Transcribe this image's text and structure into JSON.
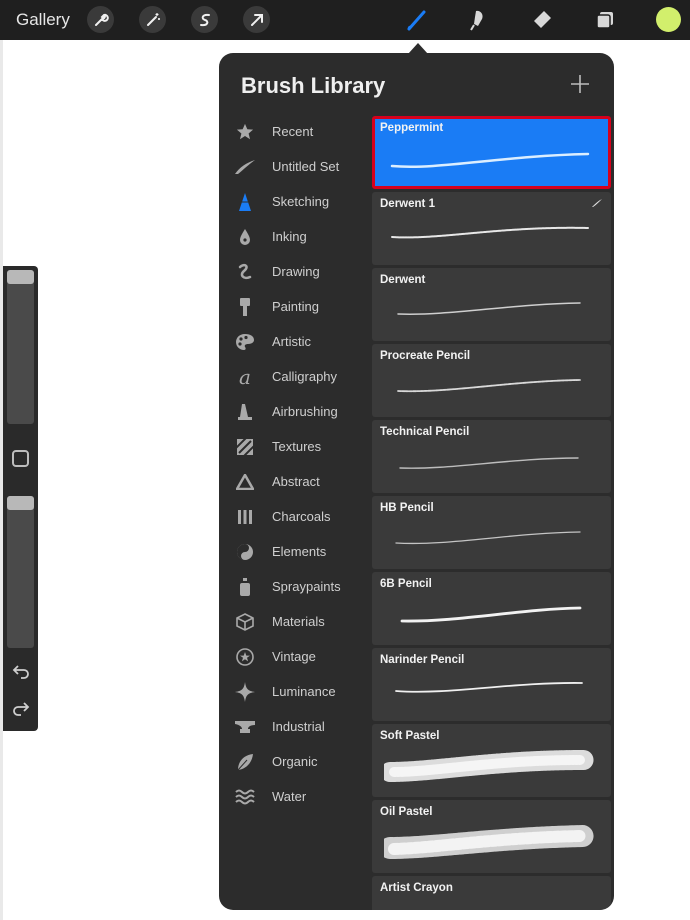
{
  "topbar": {
    "gallery_label": "Gallery",
    "tools": [
      "wrench-icon",
      "magic-wand-icon",
      "selection-s-icon",
      "transform-arrow-icon"
    ],
    "right_tools": [
      "brush-icon",
      "smudge-icon",
      "eraser-icon",
      "layers-icon"
    ],
    "active_tool": "brush",
    "accent_color": "#1a7cf5",
    "current_color": "#d2ef6c"
  },
  "library": {
    "title": "Brush Library",
    "sets": [
      {
        "label": "Recent",
        "icon": "star-icon"
      },
      {
        "label": "Untitled Set",
        "icon": "stroke-icon"
      },
      {
        "label": "Sketching",
        "icon": "pencil-tip-icon",
        "active": true
      },
      {
        "label": "Inking",
        "icon": "ink-drop-icon"
      },
      {
        "label": "Drawing",
        "icon": "squiggle-icon"
      },
      {
        "label": "Painting",
        "icon": "paint-brush-icon"
      },
      {
        "label": "Artistic",
        "icon": "palette-icon"
      },
      {
        "label": "Calligraphy",
        "icon": "script-a-icon"
      },
      {
        "label": "Airbrushing",
        "icon": "airbrush-icon"
      },
      {
        "label": "Textures",
        "icon": "texture-icon"
      },
      {
        "label": "Abstract",
        "icon": "triangle-icon"
      },
      {
        "label": "Charcoals",
        "icon": "charcoal-icon"
      },
      {
        "label": "Elements",
        "icon": "yin-yang-icon"
      },
      {
        "label": "Spraypaints",
        "icon": "spray-can-icon"
      },
      {
        "label": "Materials",
        "icon": "cube-icon"
      },
      {
        "label": "Vintage",
        "icon": "star-circle-icon"
      },
      {
        "label": "Luminance",
        "icon": "sparkle-icon"
      },
      {
        "label": "Industrial",
        "icon": "anvil-icon"
      },
      {
        "label": "Organic",
        "icon": "leaf-icon"
      },
      {
        "label": "Water",
        "icon": "waves-icon"
      }
    ],
    "brushes": [
      {
        "name": "Peppermint",
        "selected": true
      },
      {
        "name": "Derwent 1"
      },
      {
        "name": "Derwent"
      },
      {
        "name": "Procreate Pencil"
      },
      {
        "name": "Technical Pencil"
      },
      {
        "name": "HB Pencil"
      },
      {
        "name": "6B Pencil"
      },
      {
        "name": "Narinder Pencil"
      },
      {
        "name": "Soft Pastel"
      },
      {
        "name": "Oil Pastel"
      },
      {
        "name": "Artist Crayon"
      }
    ]
  }
}
